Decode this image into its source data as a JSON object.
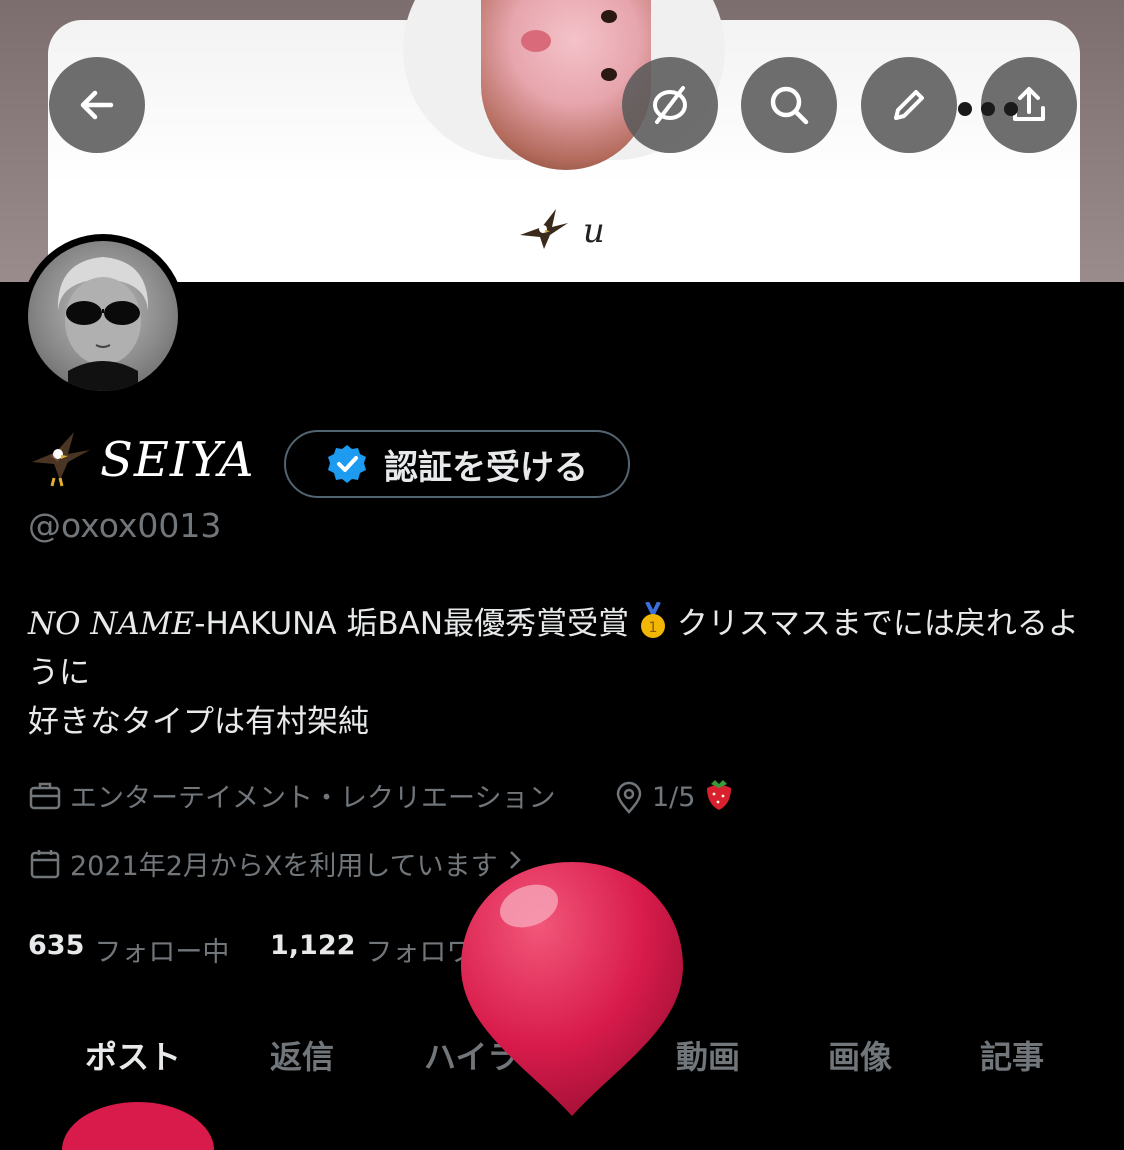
{
  "banner": {
    "name_text": "u"
  },
  "header": {
    "back_icon": "arrow-left-icon",
    "actions": [
      "hide-eye-icon",
      "search-icon",
      "pencil-icon",
      "more-icon",
      "share-icon"
    ]
  },
  "profile": {
    "display_name": "SEIYA",
    "verify_label": "認証を受ける",
    "handle": "@oxox0013",
    "bio": {
      "part1_italic": "NO NAME",
      "part1_rest": "-HAKUNA 垢BAN最優秀賞受賞",
      "part1_tail": "クリスマスまでには戻れるように",
      "line2": "好きなタイプは有村架純"
    },
    "category": "エンターテイメント・レクリエーション",
    "location": "1/5",
    "joined": "2021年2月からXを利用しています",
    "following_count": "635",
    "following_label": "フォロー中",
    "followers_count": "1,122",
    "followers_label": "フォロワー"
  },
  "tabs": [
    {
      "label": "ポスト"
    },
    {
      "label": "返信"
    },
    {
      "label": "ハイライト"
    },
    {
      "label": "動画"
    },
    {
      "label": "画像"
    },
    {
      "label": "記事"
    }
  ],
  "colors": {
    "accent_blue": "#1d9bf0",
    "muted": "#71767b",
    "balloon": "#e01d4f"
  }
}
